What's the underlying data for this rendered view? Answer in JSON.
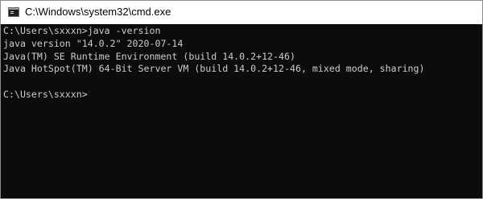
{
  "window": {
    "title": "C:\\Windows\\system32\\cmd.exe"
  },
  "console": {
    "lines": [
      "C:\\Users\\sxxxn>java -version",
      "java version \"14.0.2\" 2020-07-14",
      "Java(TM) SE Runtime Environment (build 14.0.2+12-46)",
      "Java HotSpot(TM) 64-Bit Server VM (build 14.0.2+12-46, mixed mode, sharing)",
      "",
      "C:\\Users\\sxxxn>"
    ]
  },
  "colors": {
    "console_background": "#0c0c0c",
    "console_text": "#cccccc",
    "titlebar_background": "#ffffff"
  }
}
